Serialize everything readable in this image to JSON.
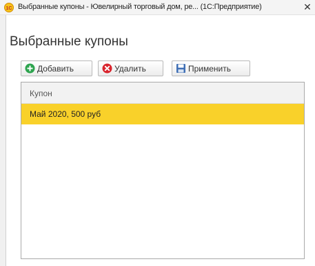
{
  "window": {
    "title": "Выбранные купоны - Ювелирный торговый дом, ре... (1С:Предприятие)",
    "logo_icon": "1c-logo-icon",
    "close_icon": "close-icon"
  },
  "form": {
    "title": "Выбранные купоны"
  },
  "toolbar": {
    "add_label": "Добавить",
    "add_icon": "plus-circle-icon",
    "delete_label": "Удалить",
    "delete_icon": "x-circle-icon",
    "apply_label": "Применить",
    "apply_icon": "save-icon"
  },
  "table": {
    "columns": [
      "Купон"
    ],
    "rows": [
      {
        "coupon": "Май 2020, 500 руб",
        "selected": true
      }
    ]
  },
  "colors": {
    "selection": "#f9d12a",
    "add_icon": "#2ea44f",
    "delete_icon": "#d9252e",
    "logo": "#f5a623"
  }
}
